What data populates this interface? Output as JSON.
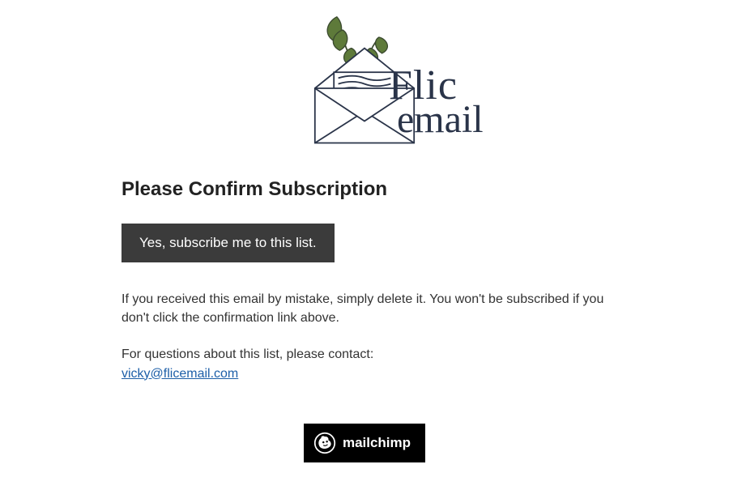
{
  "brand": {
    "serif": "Flic",
    "script": "email"
  },
  "heading": "Please Confirm Subscription",
  "cta_label": "Yes, subscribe me to this list.",
  "mistake_text": "If you received this email by mistake, simply delete it. You won't be subscribed if you don't click the confirmation link above.",
  "contact_prefix": "For questions about this list, please contact:",
  "contact_email": "vicky@flicemail.com",
  "footer": {
    "provider": "mailchimp"
  }
}
